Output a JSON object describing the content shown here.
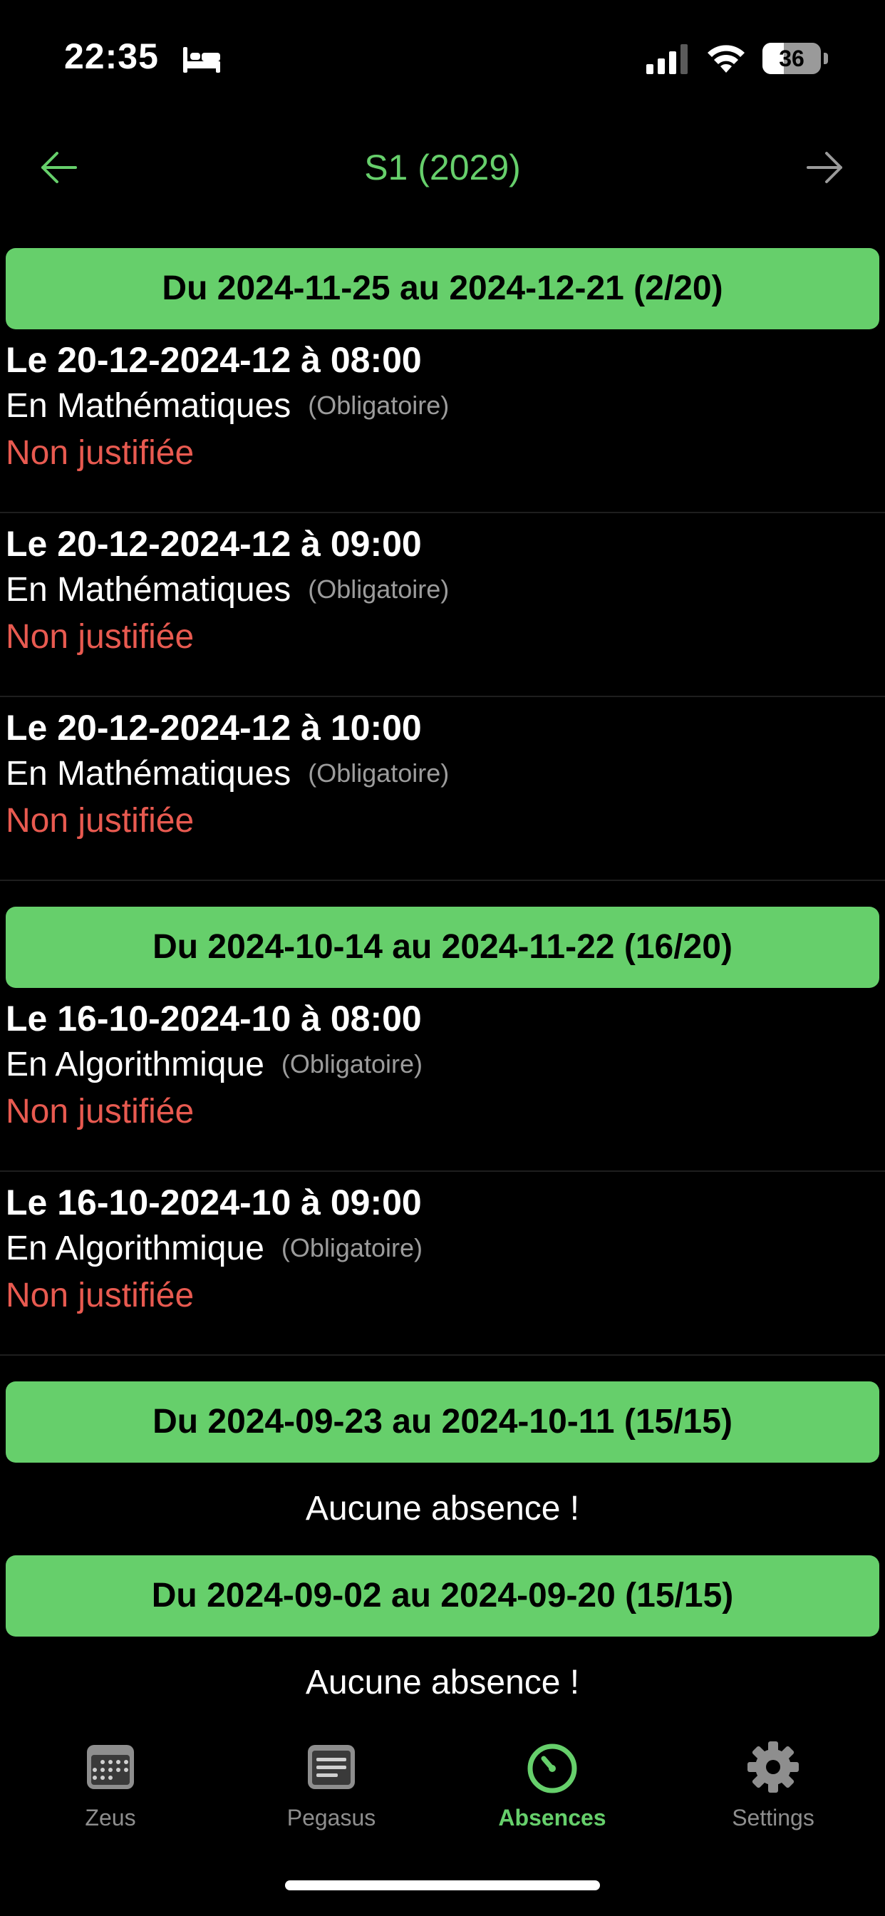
{
  "status_bar": {
    "time": "22:35",
    "battery": "36",
    "battery_level": 0.36,
    "icons": [
      "bed-icon",
      "signal-icon",
      "wifi-icon",
      "battery-icon"
    ]
  },
  "header": {
    "title": "S1 (2029)",
    "prev_icon": "arrow-left-icon",
    "next_icon": "arrow-right-icon",
    "accent_color": "#66cf6b"
  },
  "periods": [
    {
      "label": "Du 2024-11-25 au 2024-12-21 (2/20)",
      "absences": [
        {
          "date": "Le 20-12-2024-12 à 08:00",
          "course": "En Mathématiques",
          "type": "(Obligatoire)",
          "status": "Non justifiée"
        },
        {
          "date": "Le 20-12-2024-12 à 09:00",
          "course": "En Mathématiques",
          "type": "(Obligatoire)",
          "status": "Non justifiée"
        },
        {
          "date": "Le 20-12-2024-12 à 10:00",
          "course": "En Mathématiques",
          "type": "(Obligatoire)",
          "status": "Non justifiée"
        }
      ]
    },
    {
      "label": "Du 2024-10-14 au 2024-11-22 (16/20)",
      "absences": [
        {
          "date": "Le 16-10-2024-10 à 08:00",
          "course": "En Algorithmique",
          "type": "(Obligatoire)",
          "status": "Non justifiée"
        },
        {
          "date": "Le 16-10-2024-10 à 09:00",
          "course": "En Algorithmique",
          "type": "(Obligatoire)",
          "status": "Non justifiée"
        }
      ]
    },
    {
      "label": "Du 2024-09-23 au 2024-10-11 (15/15)",
      "empty_text": "Aucune absence !"
    },
    {
      "label": "Du 2024-09-02 au 2024-09-20 (15/15)",
      "empty_text": "Aucune absence !"
    }
  ],
  "tab_bar": {
    "tabs": [
      {
        "label": "Zeus",
        "icon": "calendar-icon"
      },
      {
        "label": "Pegasus",
        "icon": "document-icon"
      },
      {
        "label": "Absences",
        "icon": "timer-icon",
        "active": true
      },
      {
        "label": "Settings",
        "icon": "gear-icon"
      }
    ]
  },
  "colors": {
    "background": "#000000",
    "accent": "#66cf6b",
    "unjustified": "#e85a50",
    "muted": "#9c9c9c"
  }
}
